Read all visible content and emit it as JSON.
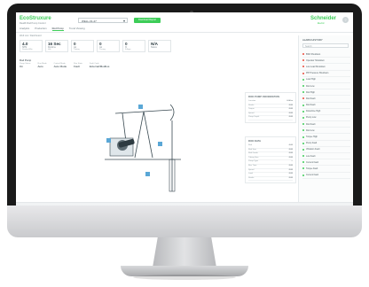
{
  "header": {
    "logo": "EcoStruxure",
    "logo_sub": "Realift Rod Pump Control",
    "well_select_value": "WELL-01-27",
    "download_label": "Download Report",
    "brand": "Schneider",
    "brand_sub": "Electric",
    "help_label": "?"
  },
  "tabs": [
    {
      "label": "Analytics"
    },
    {
      "label": "Production"
    },
    {
      "label": "Rod Pump"
    },
    {
      "label": "Trend Viewing"
    }
  ],
  "breadcrumb": "Well List / Dashboard",
  "kpis": [
    {
      "value": "4.0",
      "unit": "SPM",
      "sub": "Strokes/Min"
    },
    {
      "value": "16 Sec",
      "unit": "Runtime",
      "sub": "Idle"
    },
    {
      "value": "0",
      "unit": "psi",
      "sub": "Tubing"
    },
    {
      "value": "0",
      "unit": "psi",
      "sub": "Casing"
    },
    {
      "value": "0",
      "unit": "%",
      "sub": "Fillage"
    },
    {
      "value": "N/A",
      "unit": "Status",
      "sub": ""
    }
  ],
  "pump_panel": {
    "title": "Rod Pump",
    "columns": [
      {
        "h": "Pump Status",
        "v": "On"
      },
      {
        "h": "Run Mode",
        "v": "Auto"
      },
      {
        "h": "Control Mode",
        "v": "Auto Mode"
      },
      {
        "h": "Run State",
        "v": "Fault"
      },
      {
        "h": "Fault Code",
        "v": "External/Modbus"
      }
    ]
  },
  "well_info": {
    "title": "ROD PUMP INFORMATION",
    "rows": [
      {
        "k": "Location",
        "v": "0.00 in"
      },
      {
        "k": "Stroke",
        "v": "0.00"
      },
      {
        "k": "Torque",
        "v": "0.00"
      },
      {
        "k": "Speed",
        "v": "0.00"
      },
      {
        "k": "Pump Depth",
        "v": "0.00"
      }
    ]
  },
  "rod_data": {
    "title": "ROD DATA",
    "rows": [
      {
        "k": "Rod",
        "v": "0.00"
      },
      {
        "k": "Rod Size",
        "v": "0.00"
      },
      {
        "k": "Rod Grade",
        "v": "0.00"
      },
      {
        "k": "Tubing Size",
        "v": "0.00"
      },
      {
        "k": "Pump Type",
        "v": "--"
      },
      {
        "k": "Run Time",
        "v": "0.00"
      },
      {
        "k": "Speed",
        "v": "0.00"
      },
      {
        "k": "Load",
        "v": "0.00"
      },
      {
        "k": "Stroke",
        "v": "0.00"
      }
    ]
  },
  "alarms": {
    "title": "ALARM HISTORY",
    "search_placeholder": "Search",
    "items": [
      {
        "label": "BSD Shutdown",
        "color": "#e94a3b"
      },
      {
        "label": "Operator Shutdown",
        "color": "#e94a3b"
      },
      {
        "label": "Low Load Shutdown",
        "color": "#e94a3b"
      },
      {
        "label": "PIP Pressure Shutdown",
        "color": "#e94a3b"
      },
      {
        "label": "Load High",
        "color": "#3dcd58"
      },
      {
        "label": "Rod Low",
        "color": "#3dcd58"
      },
      {
        "label": "Rod High",
        "color": "#3dcd58"
      },
      {
        "label": "Rod Fault",
        "color": "#e94a3b"
      },
      {
        "label": "Rod Fault",
        "color": "#3dcd58"
      },
      {
        "label": "Downtime High",
        "color": "#3dcd58"
      },
      {
        "label": "Pump Low",
        "color": "#3dcd58"
      },
      {
        "label": "Rod Fault",
        "color": "#3dcd58"
      },
      {
        "label": "Rod Low",
        "color": "#3dcd58"
      },
      {
        "label": "Torque High",
        "color": "#3dcd58"
      },
      {
        "label": "Pump Fault",
        "color": "#3dcd58"
      },
      {
        "label": "Vibration Fault",
        "color": "#3dcd58"
      },
      {
        "label": "Low Fault",
        "color": "#3dcd58"
      },
      {
        "label": "Current Fault",
        "color": "#3dcd58"
      },
      {
        "label": "Torque Fault",
        "color": "#3dcd58"
      },
      {
        "label": "Current Fault",
        "color": "#3dcd58"
      }
    ]
  },
  "accent_color": "#3dcd58"
}
